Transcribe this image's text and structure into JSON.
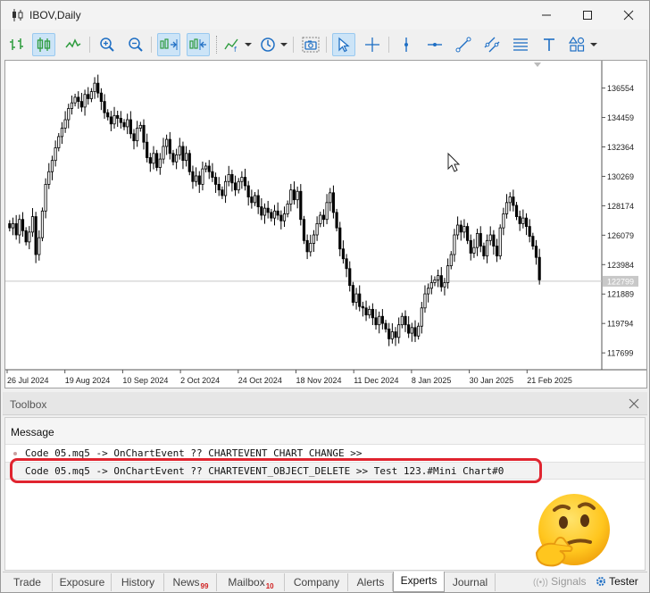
{
  "window": {
    "title": "IBOV,Daily"
  },
  "chart": {
    "price_labels": [
      "136554",
      "134459",
      "132364",
      "130269",
      "128174",
      "126079",
      "123984",
      "121889",
      "119794",
      "117699"
    ],
    "current_price": "122799",
    "date_labels": [
      "26 Jul 2024",
      "19 Aug 2024",
      "10 Sep 2024",
      "2 Oct 2024",
      "24 Oct 2024",
      "18 Nov 2024",
      "11 Dec 2024",
      "8 Jan 2025",
      "30 Jan 2025",
      "21 Feb 2025"
    ]
  },
  "chart_data": {
    "type": "candlestick",
    "series_description": "IBOV daily OHLC",
    "x_range": [
      "26 Jul 2024",
      "21 Feb 2025"
    ],
    "ylim": [
      116500,
      138500
    ],
    "closes": [
      126600,
      126900,
      126100,
      127200,
      126400,
      125600,
      126300,
      127400,
      124700,
      125900,
      127800,
      129700,
      130600,
      131400,
      132300,
      133100,
      133700,
      134300,
      135100,
      135500,
      135900,
      135600,
      135200,
      136100,
      135800,
      136300,
      136900,
      136200,
      135600,
      134800,
      134500,
      134000,
      134600,
      134400,
      134100,
      133800,
      134300,
      133300,
      132800,
      133700,
      133900,
      132700,
      131600,
      131200,
      131900,
      130900,
      131500,
      132400,
      132900,
      131900,
      131300,
      131800,
      132400,
      131400,
      131900,
      130600,
      129900,
      130300,
      129700,
      130800,
      131000,
      130600,
      130200,
      129700,
      129300,
      128900,
      129900,
      130400,
      129800,
      129300,
      129900,
      130200,
      129600,
      128800,
      128400,
      128900,
      128100,
      127500,
      128000,
      127700,
      127300,
      127800,
      127500,
      127100,
      127600,
      128300,
      129300,
      128600,
      129200,
      127200,
      125700,
      124900,
      125500,
      126100,
      126900,
      127500,
      127200,
      128400,
      129100,
      127700,
      126600,
      125100,
      124400,
      123700,
      122500,
      121300,
      121900,
      121000,
      120900,
      120400,
      120800,
      120200,
      119700,
      120300,
      119800,
      119400,
      118700,
      119200,
      118800,
      119700,
      120300,
      119700,
      119100,
      119500,
      118900,
      119600,
      120900,
      121900,
      122300,
      122700,
      122900,
      123200,
      122400,
      122700,
      123900,
      124700,
      126100,
      126800,
      126300,
      126700,
      125700,
      124800,
      125200,
      126200,
      125300,
      124600,
      125700,
      126100,
      125300,
      124600,
      126600,
      127600,
      128400,
      128800,
      128200,
      127400,
      126900,
      127300,
      126700,
      126000,
      125300,
      124500,
      122900
    ]
  },
  "toolbox": {
    "title": "Toolbox",
    "column_header": "Message",
    "messages": [
      "Code 05.mq5 -> OnChartEvent ?? CHARTEVENT_CHART_CHANGE >>",
      "Code 05.mq5 -> OnChartEvent ?? CHARTEVENT_OBJECT_DELETE >> Test 123.#Mini Chart#0"
    ]
  },
  "tabs": {
    "trade": "Trade",
    "exposure": "Exposure",
    "history": "History",
    "news": "News",
    "news_count": "99",
    "mailbox": "Mailbox",
    "mailbox_count": "10",
    "company": "Company",
    "alerts": "Alerts",
    "experts": "Experts",
    "journal": "Journal",
    "signals": "Signals",
    "tester": "Tester"
  },
  "colors": {
    "highlight": "#e0242f",
    "active_tool": "#cce4f7",
    "tool_green": "#2e9c3e",
    "tool_blue": "#1f6fc4"
  }
}
